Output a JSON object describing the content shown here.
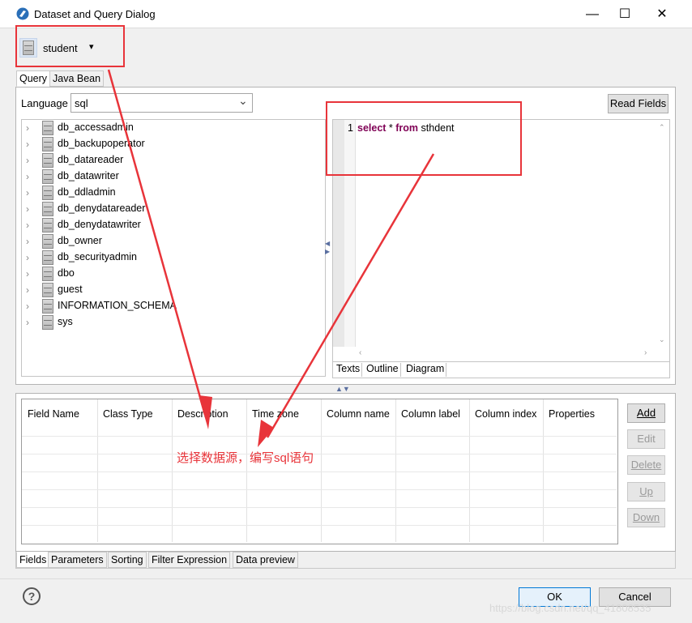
{
  "window": {
    "title": "Dataset and Query Dialog",
    "controls": {
      "minimize": "—",
      "maximize": "☐",
      "close": "✕"
    }
  },
  "datasource": {
    "name": "student",
    "dropdown_glyph": "▾"
  },
  "top_tabs": [
    "Query",
    "Java Bean"
  ],
  "language": {
    "label": "Language",
    "value": "sql",
    "chevron": "⌄"
  },
  "read_fields_label": "Read Fields",
  "schema_tree": [
    "db_accessadmin",
    "db_backupoperator",
    "db_datareader",
    "db_datawriter",
    "db_ddladmin",
    "db_denydatareader",
    "db_denydatawriter",
    "db_owner",
    "db_securityadmin",
    "dbo",
    "guest",
    "INFORMATION_SCHEMA",
    "sys"
  ],
  "editor": {
    "line_number": "1",
    "query": {
      "kw1": "select",
      "t1": " * ",
      "kw2": "from",
      "t2": " sthdent"
    },
    "tabs": [
      "Texts",
      "Outline",
      "Diagram"
    ]
  },
  "fields_table": {
    "columns": [
      "Field Name",
      "Class Type",
      "Description",
      "Time zone",
      "Column name",
      "Column label",
      "Column index",
      "Properties"
    ]
  },
  "side_buttons": [
    {
      "label": "Add",
      "enabled": true
    },
    {
      "label": "Edit",
      "enabled": false
    },
    {
      "label": "Delete",
      "enabled": false
    },
    {
      "label": "Up",
      "enabled": false
    },
    {
      "label": "Down",
      "enabled": false
    }
  ],
  "bottom_tabs": [
    "Fields",
    "Parameters",
    "Sorting",
    "Filter Expression",
    "Data preview"
  ],
  "footer": {
    "help": "?",
    "ok": "OK",
    "cancel": "Cancel"
  },
  "annotation": {
    "text": "选择数据源，编写sql语句",
    "color": "#e8343a"
  },
  "watermark": "https://blog.csdn.net/qq_41808535"
}
